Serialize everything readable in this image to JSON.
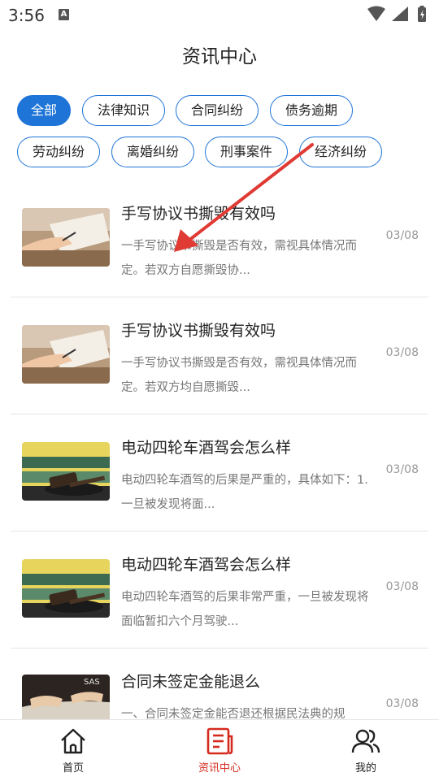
{
  "status_bar": {
    "time": "3:56",
    "indicator": "A"
  },
  "page_title": "资讯中心",
  "categories": [
    {
      "label": "全部",
      "active": true
    },
    {
      "label": "法律知识",
      "active": false
    },
    {
      "label": "合同纠纷",
      "active": false
    },
    {
      "label": "债务逾期",
      "active": false
    },
    {
      "label": "劳动纠纷",
      "active": false
    },
    {
      "label": "离婚纠纷",
      "active": false
    },
    {
      "label": "刑事案件",
      "active": false
    },
    {
      "label": "经济纠纷",
      "active": false
    }
  ],
  "articles": [
    {
      "title": "手写协议书撕毁有效吗",
      "summary": "一手写协议书撕毁是否有效，需视具体情况而定。若双方自愿撕毁协...",
      "date": "03/08",
      "thumb": "writing"
    },
    {
      "title": "手写协议书撕毁有效吗",
      "summary": "一手写协议书撕毁是否有效，需视具体情况而定。若双方均自愿撕毁...",
      "date": "03/08",
      "thumb": "writing"
    },
    {
      "title": "电动四轮车酒驾会怎么样",
      "summary": "电动四轮车酒驾的后果是严重的，具体如下：1. 一旦被发现将面...",
      "date": "03/08",
      "thumb": "gavel"
    },
    {
      "title": "电动四轮车酒驾会怎么样",
      "summary": "电动四轮车酒驾的后果非常严重，一旦被发现将面临暂扣六个月驾驶...",
      "date": "03/08",
      "thumb": "gavel"
    },
    {
      "title": "合同未签定金能退么",
      "summary": "一、合同未签定金能否退还根据民法典的规",
      "date": "03/08",
      "thumb": "book"
    }
  ],
  "tabs": [
    {
      "label": "首页",
      "icon": "home-icon",
      "active": false
    },
    {
      "label": "资讯中心",
      "icon": "news-icon",
      "active": true
    },
    {
      "label": "我的",
      "icon": "profile-icon",
      "active": false
    }
  ],
  "colors": {
    "accent": "#1f74d8",
    "active_tab": "#d52a1e",
    "annotation_arrow": "#e03a34"
  }
}
